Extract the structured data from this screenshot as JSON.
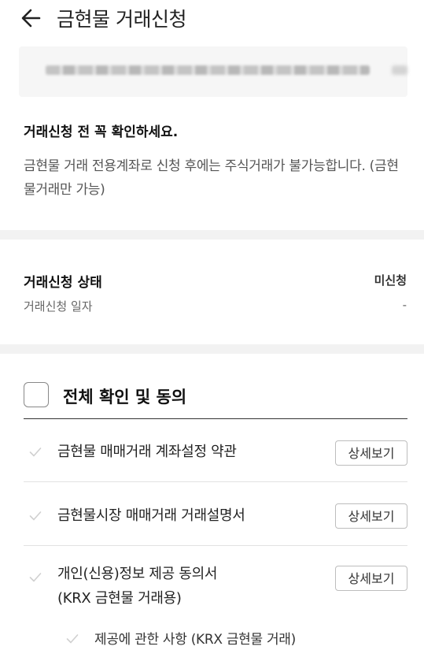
{
  "header": {
    "back_icon": "back-arrow-icon",
    "title": "금현물 거래신청"
  },
  "account": {
    "masked_number": ""
  },
  "notice": {
    "title": "거래신청 전 꼭 확인하세요.",
    "body": "금현물 거래 전용계좌로 신청 후에는 주식거래가 불가능합니다. (금현물거래만 가능)"
  },
  "status": {
    "label": "거래신청 상태",
    "value": "미신청",
    "date_label": "거래신청 일자",
    "date_value": "-"
  },
  "agreement": {
    "all_label": "전체 확인 및 동의",
    "items": [
      {
        "label": "금현물 매매거래 계좌설정 약관",
        "button": "상세보기"
      },
      {
        "label": "금현물시장 매매거래 거래설명서",
        "button": "상세보기"
      },
      {
        "label_line1": "개인(신용)정보 제공 동의서",
        "label_line2": "(KRX 금현물 거래용)",
        "button": "상세보기"
      }
    ],
    "sub_items": [
      {
        "label": "제공에 관한 사항 (KRX 금현물 거래)"
      }
    ]
  },
  "colors": {
    "check_mark": "#d0d0d0",
    "text_primary": "#222222",
    "divider": "#f2f2f2"
  }
}
